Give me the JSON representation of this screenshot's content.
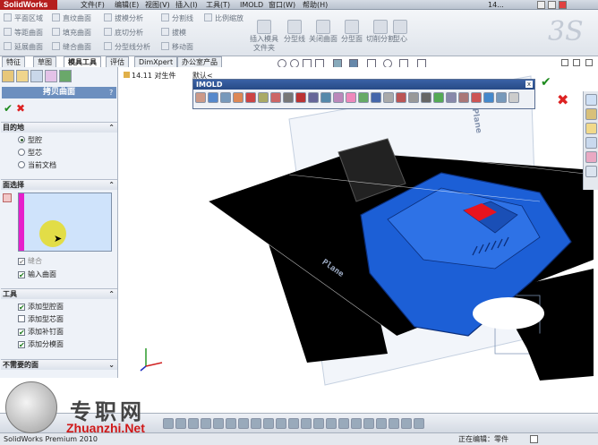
{
  "app": {
    "brand": "SolidWorks",
    "title_suffix": "14..."
  },
  "menu": [
    "文件(F)",
    "编辑(E)",
    "视图(V)",
    "插入(I)",
    "工具(T)",
    "IMOLD",
    "窗口(W)",
    "帮助(H)"
  ],
  "ribbon": {
    "col1": [
      "平面区域",
      "等距曲面",
      "直纹曲面",
      "填充曲面",
      "延展曲面",
      "缝合曲面"
    ],
    "col2": [
      "拔模分析",
      "底切分析",
      "分型线分析"
    ],
    "col3": [
      "分割线",
      "拔模",
      "移动面"
    ],
    "col4": [
      "比例缩放"
    ],
    "big": [
      "插入模具文件夹",
      "分型线",
      "关闭曲面",
      "分型面",
      "切削分割",
      "型心"
    ]
  },
  "tabs": [
    "特征",
    "草图",
    "模具工具",
    "评估",
    "DimXpert",
    "办公室产品"
  ],
  "active_tab": "模具工具",
  "breadcrumb": "14.11 对生件",
  "breadcrumb2": "默认<",
  "panel": {
    "title": "拷贝曲面",
    "section1": "目的地",
    "dest_options": [
      "型腔",
      "型芯",
      "当前文档"
    ],
    "section2": "面选择",
    "knit_label": "缝合",
    "input_surface": "输入曲面",
    "section3": "工具",
    "tool_options": [
      "添加型腔面",
      "添加型芯面",
      "添加补钉面",
      "添加分模面"
    ],
    "section4": "不需要的面"
  },
  "imold": {
    "title": "IMOLD"
  },
  "viewport": {
    "plane_label": "Plane",
    "plane_label2": "Plane"
  },
  "status": {
    "left": "SolidWorks Premium 2010",
    "mid": "正在编辑：零件"
  },
  "watermark": {
    "title": "专职网",
    "url": "Zhuanzhi.Net"
  },
  "colors": {
    "part_blue": "#1c5fd6",
    "highlight_red": "#e8141e",
    "plane_black": "#000000",
    "accent": "#6c8fbf"
  }
}
